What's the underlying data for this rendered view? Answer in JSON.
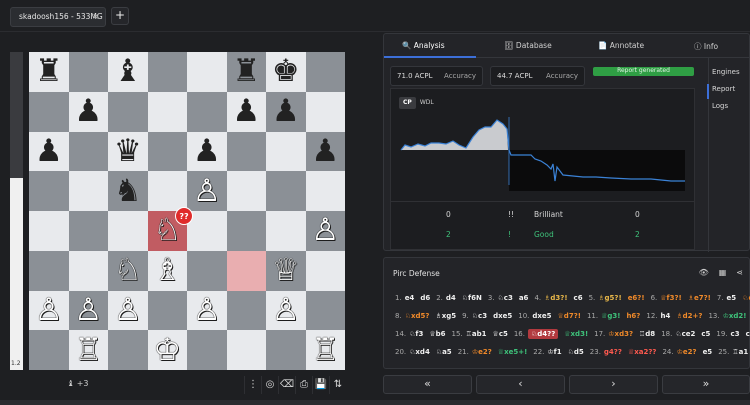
{
  "tab": {
    "title": "skadoosh156 - 533MG",
    "close": "×",
    "add": "+"
  },
  "eval": {
    "value": "1.2"
  },
  "board": {
    "rows": [
      [
        "♜",
        "",
        "♝",
        "",
        "",
        "♜",
        "♚",
        ""
      ],
      [
        "",
        "♟",
        "",
        "",
        "",
        "♟",
        "♟",
        ""
      ],
      [
        "♟",
        "",
        "♛",
        "",
        "♟",
        "",
        "",
        "♟"
      ],
      [
        "",
        "",
        "♞",
        "",
        "♙",
        "",
        "",
        ""
      ],
      [
        "",
        "",
        "",
        "♘",
        "",
        "",
        "",
        "♙"
      ],
      [
        "",
        "",
        "♘",
        "♗",
        "",
        "",
        "♕",
        ""
      ],
      [
        "♙",
        "♙",
        "♙",
        "",
        "♙",
        "",
        "♙",
        ""
      ],
      [
        "",
        "♖",
        "",
        "♔",
        "",
        "",
        "",
        "♖"
      ]
    ],
    "colors": [
      [
        "b",
        "",
        "b",
        "",
        "",
        "b",
        "b",
        ""
      ],
      [
        "",
        "b",
        "",
        "",
        "",
        "b",
        "b",
        ""
      ],
      [
        "b",
        "",
        "b",
        "",
        "b",
        "",
        "",
        "b"
      ],
      [
        "",
        "",
        "b",
        "",
        "w",
        "",
        "",
        ""
      ],
      [
        "",
        "",
        "",
        "w",
        "",
        "",
        "",
        "w"
      ],
      [
        "",
        "",
        "w",
        "w",
        "",
        "",
        "w",
        ""
      ],
      [
        "w",
        "w",
        "w",
        "",
        "w",
        "",
        "w",
        ""
      ],
      [
        "",
        "w",
        "",
        "w",
        "",
        "",
        "",
        "w"
      ]
    ],
    "blunder_badge": "??"
  },
  "footer": {
    "material_icon": "♝",
    "material": "+3",
    "tools": [
      "⋮",
      "◎",
      "⌫",
      "⎙",
      "💾",
      "⇅"
    ]
  },
  "panel": {
    "tabs": [
      {
        "icon": "🔍",
        "label": "Analysis"
      },
      {
        "icon": "🗄",
        "label": "Database"
      },
      {
        "icon": "📄",
        "label": "Annotate"
      },
      {
        "icon": "ⓘ",
        "label": "Info"
      }
    ],
    "white_acpl": "71.0 ACPL",
    "white_acc": "Accuracy",
    "black_acpl": "44.7 ACPL",
    "black_acc": "Accuracy",
    "report_button": "Report generated",
    "side": [
      "Engines",
      "Report",
      "Logs"
    ],
    "graph_toggle": [
      "CP",
      "WDL"
    ],
    "stats": [
      {
        "w": "0",
        "sym": "!!",
        "label": "Brilliant",
        "b": "0"
      },
      {
        "w": "2",
        "sym": "!",
        "label": "Good",
        "b": "2"
      }
    ]
  },
  "moves": {
    "opening": "Pirc Defense",
    "icons": [
      "👁",
      "▦",
      "⋖"
    ],
    "lines": [
      [
        [
          "1.",
          "e4"
        ],
        [
          "",
          "d6"
        ],
        [
          "2.",
          "d4"
        ],
        [
          "",
          "♘f6N"
        ],
        [
          "3.",
          "♘c3"
        ],
        [
          "",
          "a6"
        ],
        [
          "4.",
          "♗d3?!",
          "in"
        ],
        [
          "",
          "c6"
        ],
        [
          "5.",
          "♗g5?!",
          "in"
        ],
        [
          "",
          "e6?!",
          "mi"
        ],
        [
          "6.",
          "♕f3?!",
          "mi"
        ],
        [
          "",
          "♗e7?!",
          "mi"
        ],
        [
          "7.",
          "e5"
        ],
        [
          "",
          "♘d5?!",
          "mi"
        ]
      ],
      [
        [
          "8.",
          "♘xd5?",
          "mi"
        ],
        [
          "",
          "♗xg5"
        ],
        [
          "9.",
          "♘c3"
        ],
        [
          "",
          "dxe5"
        ],
        [
          "10.",
          "dxe5"
        ],
        [
          "",
          "♕d7?!",
          "mi"
        ],
        [
          "11.",
          "♕g3!",
          "gd"
        ],
        [
          "",
          "h6?",
          "mi"
        ],
        [
          "12.",
          "h4"
        ],
        [
          "",
          "♗d2+?",
          "mi"
        ],
        [
          "13.",
          "♔xd2!",
          "gd"
        ],
        [
          "",
          "O-O"
        ]
      ],
      [
        [
          "14.",
          "♘f3"
        ],
        [
          "",
          "♕b6"
        ],
        [
          "15.",
          "♖ab1"
        ],
        [
          "",
          "♕c5"
        ],
        [
          "16.",
          "♘d4??",
          "hl"
        ],
        [
          "",
          "♕xd3!",
          "gd"
        ],
        [
          "17.",
          "♔xd3?",
          "mi"
        ],
        [
          "",
          "♖d8"
        ],
        [
          "18.",
          "♘ce2"
        ],
        [
          "",
          "c5"
        ],
        [
          "19.",
          "c3"
        ],
        [
          "",
          "cxd4"
        ]
      ],
      [
        [
          "20.",
          "♘xd4"
        ],
        [
          "",
          "♘a5"
        ],
        [
          "21.",
          "♔e2?",
          "mi"
        ],
        [
          "",
          "♕xe5+!",
          "gd"
        ],
        [
          "22.",
          "♔f1"
        ],
        [
          "",
          "♘d5"
        ],
        [
          "23.",
          "g4??",
          "bl"
        ],
        [
          "",
          "♕xa2??",
          "bl"
        ],
        [
          "24.",
          "♔e2?",
          "mi"
        ],
        [
          "",
          "e5"
        ],
        [
          "25.",
          "♖a1"
        ]
      ]
    ]
  },
  "nav": [
    "«",
    "‹",
    "›",
    "»"
  ]
}
